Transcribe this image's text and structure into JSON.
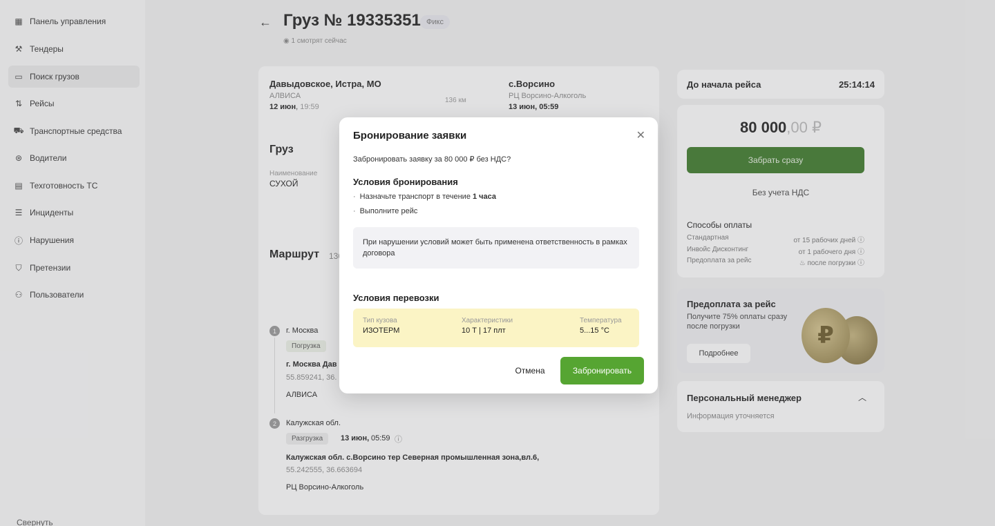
{
  "sidebar": {
    "items": [
      {
        "label": "Панель управления",
        "icon": "dashboard-icon"
      },
      {
        "label": "Тендеры",
        "icon": "hammer-icon"
      },
      {
        "label": "Поиск грузов",
        "icon": "search-cargo-icon"
      },
      {
        "label": "Рейсы",
        "icon": "route-icon"
      },
      {
        "label": "Транспортные средства",
        "icon": "truck-icon"
      },
      {
        "label": "Водители",
        "icon": "steering-wheel-icon"
      },
      {
        "label": "Техготовность ТС",
        "icon": "calendar-icon"
      },
      {
        "label": "Инциденты",
        "icon": "document-icon"
      },
      {
        "label": "Нарушения",
        "icon": "warning-icon"
      },
      {
        "label": "Претензии",
        "icon": "shield-icon"
      },
      {
        "label": "Пользователи",
        "icon": "users-icon"
      }
    ],
    "footer": "Свернуть"
  },
  "header": {
    "title": "Груз № 19335351",
    "badge": "Фикс",
    "viewers": "1 смотрят сейчас"
  },
  "route_summary": {
    "from_city": "Давыдовское, Истра, МО",
    "from_company": "АЛВИСА",
    "from_date": "12 июн",
    "from_time": "19:59",
    "distance": "136 км",
    "to_city": "с.Ворсино",
    "to_company": "РЦ Ворсино-Алкоголь",
    "to_date": "13 июн, 05:59"
  },
  "cargo": {
    "title": "Груз",
    "name_label": "Наименование",
    "name_value": "СУХОЙ"
  },
  "route": {
    "title": "Маршрут",
    "distance_short": "136",
    "stops": [
      {
        "num": "1",
        "city": "г. Москва",
        "tag": "Погрузка",
        "address": "г. Москва Дав",
        "coords": "55.859241, 36.",
        "company": "АЛВИСА"
      },
      {
        "num": "2",
        "city": "Калужская обл.",
        "tag": "Разгрузка",
        "date": "13 июн,",
        "time": "05:59",
        "address": "Калужская обл. с.Ворсино тер Северная промышленная зона,вл.6,",
        "coords": "55.242555, 36.663694",
        "company": "РЦ Ворсино-Алкоголь"
      }
    ]
  },
  "timer": {
    "label": "До начала рейса",
    "value": "25:14:14"
  },
  "price": {
    "main": "80 000",
    "cents": ",00 ₽",
    "take_button": "Забрать сразу",
    "vat_note": "Без учета НДС",
    "payment_title": "Способы оплаты",
    "payments": [
      {
        "name": "Стандартная",
        "term": "от 15 рабочих дней"
      },
      {
        "name": "Инвойс Дисконтинг",
        "term": "от 1 рабочего дня"
      },
      {
        "name": "Предоплата за рейс",
        "term": "после погрузки"
      }
    ]
  },
  "prepay": {
    "title": "Предоплата за рейс",
    "text": "Получите 75% оплаты сразу после погрузки",
    "button": "Подробнее",
    "coin_symbol": "₽"
  },
  "manager": {
    "title": "Персональный менеджер",
    "info": "Информация уточняется"
  },
  "modal": {
    "title": "Бронирование заявки",
    "question": "Забронировать заявку за 80 000 ₽ без НДС?",
    "conditions_title": "Условия бронирования",
    "condition_1_prefix": "Назначьте транспорт в течение ",
    "condition_1_bold": "1 часа",
    "condition_2": "Выполните рейс",
    "warning": "При нарушении условий может быть применена ответственность в рамках договора",
    "transport_title": "Условия перевозки",
    "transport": [
      {
        "label": "Тип кузова",
        "value": "ИЗОТЕРМ"
      },
      {
        "label": "Характеристики",
        "value": "10 Т | 17 плт"
      },
      {
        "label": "Температура",
        "value": "5...15 °С"
      }
    ],
    "cancel": "Отмена",
    "confirm": "Забронировать"
  },
  "colors": {
    "primary_green": "#56a532",
    "dark_green": "#3d7a29",
    "conditions_bg": "#fbf4c5"
  }
}
